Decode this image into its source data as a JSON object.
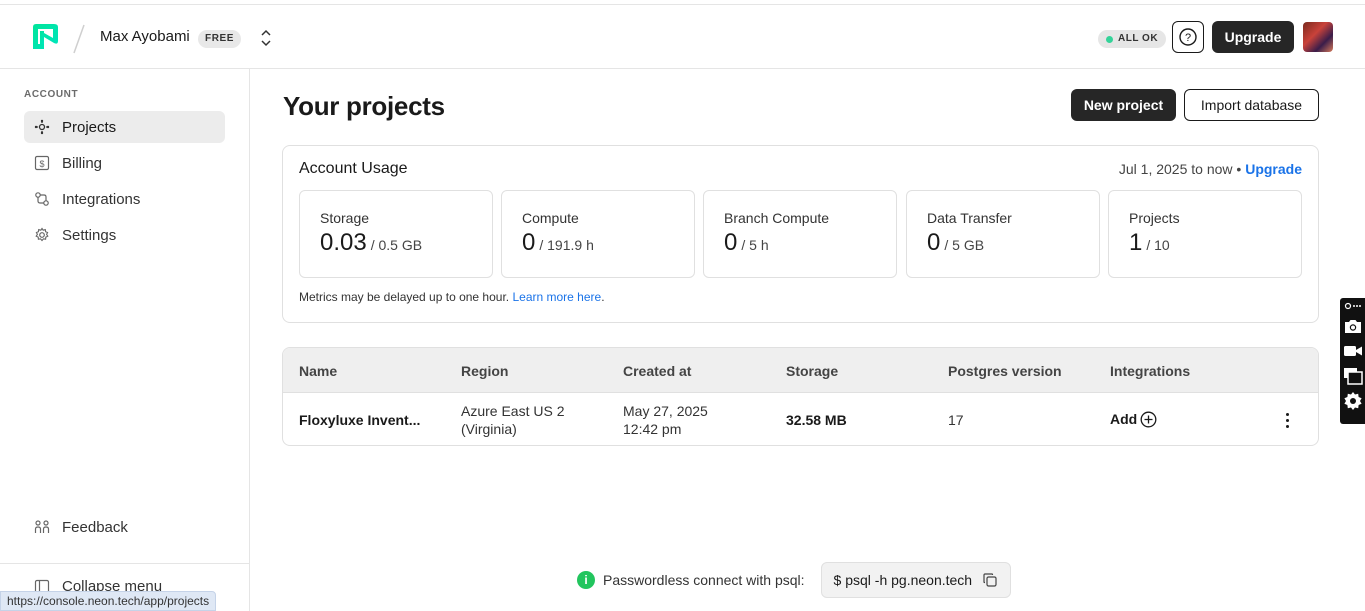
{
  "topbar": {
    "org_name": "Max Ayobami",
    "plan": "FREE",
    "status": "ALL OK",
    "help_label": "?",
    "upgrade_label": "Upgrade"
  },
  "sidebar": {
    "section_heading": "ACCOUNT",
    "items": [
      {
        "label": "Projects",
        "icon": "projects-icon",
        "active": true
      },
      {
        "label": "Billing",
        "icon": "billing-icon"
      },
      {
        "label": "Integrations",
        "icon": "integrations-icon"
      },
      {
        "label": "Settings",
        "icon": "settings-icon"
      }
    ],
    "feedback_label": "Feedback",
    "collapse_label": "Collapse menu"
  },
  "main": {
    "title": "Your projects",
    "new_project_label": "New project",
    "import_label": "Import database"
  },
  "usage": {
    "title": "Account Usage",
    "period": "Jul 1, 2025 to now",
    "separator": "•",
    "upgrade_link": "Upgrade",
    "metrics": [
      {
        "label": "Storage",
        "value": "0.03",
        "limit": "/ 0.5 GB"
      },
      {
        "label": "Compute",
        "value": "0",
        "limit": "/ 191.9 h"
      },
      {
        "label": "Branch Compute",
        "value": "0",
        "limit": "/ 5 h"
      },
      {
        "label": "Data Transfer",
        "value": "0",
        "limit": "/ 5 GB"
      },
      {
        "label": "Projects",
        "value": "1",
        "limit": "/ 10"
      }
    ],
    "note": "Metrics may be delayed up to one hour.",
    "note_link": "Learn more here",
    "note_end": "."
  },
  "table": {
    "headers": [
      "Name",
      "Region",
      "Created at",
      "Storage",
      "Postgres version",
      "Integrations"
    ],
    "rows": [
      {
        "name": "Floxyluxe Invent...",
        "region_line1": "Azure East US 2",
        "region_line2": "(Virginia)",
        "created_line1": "May 27, 2025",
        "created_line2": "12:42 pm",
        "storage": "32.58 MB",
        "postgres": "17",
        "integrations": "Add"
      }
    ]
  },
  "connect": {
    "info": "i",
    "text": "Passwordless connect with psql:",
    "command": "$ psql -h pg.neon.tech"
  },
  "browser": {
    "status_url": "https://console.neon.tech/app/projects"
  },
  "colors": {
    "accent": "#1a73e8",
    "brand": "#00e599",
    "dark_button": "#262626",
    "status_ok": "#34d399"
  }
}
